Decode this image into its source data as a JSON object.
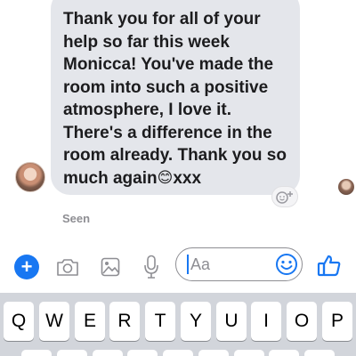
{
  "message": {
    "lines": [
      "Thank you for all of your",
      "help so far this week",
      "Monicca! You've made the",
      "room into such a positive",
      "atmosphere, I love it.",
      "There's a difference in the",
      "room already. Thank you so"
    ],
    "last_line_text": "much again",
    "last_line_emoji": "😊",
    "last_line_suffix": "xxx"
  },
  "status": {
    "seen": "Seen"
  },
  "composer": {
    "placeholder": "Aa"
  },
  "colors": {
    "accent": "#1877f2",
    "bubble": "#e4e6eb",
    "keyboard": "#d2d5db"
  },
  "icons": [
    "plus-icon",
    "camera-icon",
    "photo-icon",
    "microphone-icon",
    "smiley-icon",
    "thumbs-up-icon",
    "add-reaction-icon"
  ],
  "keyboard": {
    "row1": [
      "Q",
      "W",
      "E",
      "R",
      "T",
      "Y",
      "U",
      "I",
      "O",
      "P"
    ]
  }
}
